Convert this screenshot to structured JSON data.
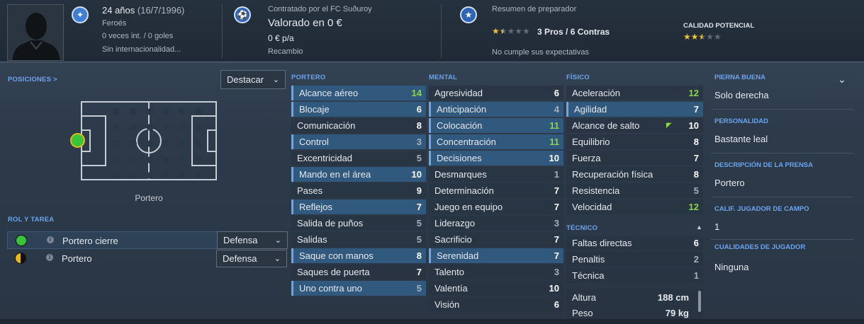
{
  "header": {
    "age": "24 años",
    "dob": "(16/7/1996)",
    "nationality": "Feroés",
    "intl_caps": "0 veces int. / 0 goles",
    "intl_status": "Sin internacionalidad...",
    "club_status": "Contratado por el FC Suðuroy",
    "value": "Valorado en 0 €",
    "wage": "0 € p/a",
    "role": "Recambio",
    "coach_title": "Resumen de preparador",
    "pros_cons": "3 Pros / 6 Contras",
    "coach_note": "No cumple sus expectativas",
    "potential_label": "CALIDAD POTENCIAL",
    "coach_stars": 1.5,
    "potential_stars": 2.5
  },
  "positions": {
    "label": "POSICIONES >",
    "dropdown": "Destacar",
    "position_name": "Portero"
  },
  "roles": {
    "label": "ROL Y TAREA",
    "items": [
      {
        "name": "Portero cierre",
        "duty": "Defensa",
        "rating": "full"
      },
      {
        "name": "Portero",
        "duty": "Defensa",
        "rating": "half"
      }
    ]
  },
  "attributes": {
    "portero": {
      "title": "PORTERO",
      "items": [
        {
          "label": "Alcance aéreo",
          "value": "14",
          "hl": true,
          "c": "g"
        },
        {
          "label": "Blocaje",
          "value": "6",
          "hl": true,
          "c": "w"
        },
        {
          "label": "Comunicación",
          "value": "8",
          "hl": false,
          "c": "w"
        },
        {
          "label": "Control",
          "value": "3",
          "hl": true,
          "c": "gr"
        },
        {
          "label": "Excentricidad",
          "value": "5",
          "hl": false,
          "c": "gr"
        },
        {
          "label": "Mando en el área",
          "value": "10",
          "hl": true,
          "c": "w"
        },
        {
          "label": "Pases",
          "value": "9",
          "hl": false,
          "c": "w"
        },
        {
          "label": "Reflejos",
          "value": "7",
          "hl": true,
          "c": "w"
        },
        {
          "label": "Salida de puños",
          "value": "5",
          "hl": false,
          "c": "gr"
        },
        {
          "label": "Salidas",
          "value": "5",
          "hl": false,
          "c": "gr"
        },
        {
          "label": "Saque con manos",
          "value": "8",
          "hl": true,
          "c": "w"
        },
        {
          "label": "Saques de puerta",
          "value": "7",
          "hl": false,
          "c": "w"
        },
        {
          "label": "Uno contra uno",
          "value": "5",
          "hl": true,
          "c": "gr"
        }
      ]
    },
    "mental": {
      "title": "MENTAL",
      "items": [
        {
          "label": "Agresividad",
          "value": "6",
          "hl": false,
          "c": "w"
        },
        {
          "label": "Anticipación",
          "value": "4",
          "hl": true,
          "c": "gr"
        },
        {
          "label": "Colocación",
          "value": "11",
          "hl": true,
          "c": "g"
        },
        {
          "label": "Concentración",
          "value": "11",
          "hl": true,
          "c": "g"
        },
        {
          "label": "Decisiones",
          "value": "10",
          "hl": true,
          "c": "w"
        },
        {
          "label": "Desmarques",
          "value": "1",
          "hl": false,
          "c": "gr"
        },
        {
          "label": "Determinación",
          "value": "7",
          "hl": false,
          "c": "w"
        },
        {
          "label": "Juego en equipo",
          "value": "7",
          "hl": false,
          "c": "w"
        },
        {
          "label": "Liderazgo",
          "value": "3",
          "hl": false,
          "c": "gr"
        },
        {
          "label": "Sacrificio",
          "value": "7",
          "hl": false,
          "c": "w"
        },
        {
          "label": "Serenidad",
          "value": "7",
          "hl": true,
          "c": "w"
        },
        {
          "label": "Talento",
          "value": "3",
          "hl": false,
          "c": "gr"
        },
        {
          "label": "Valentía",
          "value": "10",
          "hl": false,
          "c": "w"
        },
        {
          "label": "Visión",
          "value": "6",
          "hl": false,
          "c": "w"
        }
      ]
    },
    "fisico": {
      "title": "FÍSICO",
      "items": [
        {
          "label": "Aceleración",
          "value": "12",
          "hl": false,
          "c": "g"
        },
        {
          "label": "Agilidad",
          "value": "7",
          "hl": true,
          "c": "w"
        },
        {
          "label": "Alcance de salto",
          "value": "10",
          "hl": false,
          "c": "w",
          "arrow": true
        },
        {
          "label": "Equilibrio",
          "value": "8",
          "hl": false,
          "c": "w"
        },
        {
          "label": "Fuerza",
          "value": "7",
          "hl": false,
          "c": "w"
        },
        {
          "label": "Recuperación física",
          "value": "8",
          "hl": false,
          "c": "w"
        },
        {
          "label": "Resistencia",
          "value": "5",
          "hl": false,
          "c": "gr"
        },
        {
          "label": "Velocidad",
          "value": "12",
          "hl": false,
          "c": "g"
        }
      ]
    },
    "tecnico": {
      "title": "TÉCNICO",
      "items": [
        {
          "label": "Faltas directas",
          "value": "6",
          "hl": false,
          "c": "w"
        },
        {
          "label": "Penaltis",
          "value": "2",
          "hl": false,
          "c": "gr"
        },
        {
          "label": "Técnica",
          "value": "1",
          "hl": false,
          "c": "gr"
        }
      ]
    },
    "physical": [
      {
        "label": "Altura",
        "value": "188 cm"
      },
      {
        "label": "Peso",
        "value": "79 kg"
      }
    ]
  },
  "profile": {
    "foot_label": "PIERNA BUENA",
    "foot": "Solo derecha",
    "personality_label": "PERSONALIDAD",
    "personality": "Bastante leal",
    "press_label": "DESCRIPCIÓN DE LA PRENSA",
    "press": "Portero",
    "outfield_label": "CALIF. JUGADOR DE CAMPO",
    "outfield": "1",
    "qualities_label": "CUALIDADES DE JUGADOR",
    "qualities": "Ninguna"
  },
  "colors": {
    "accent": "#6da4ec",
    "highlight_row": "#31597e",
    "good_value": "#8bd64c",
    "star": "#f2c230"
  }
}
